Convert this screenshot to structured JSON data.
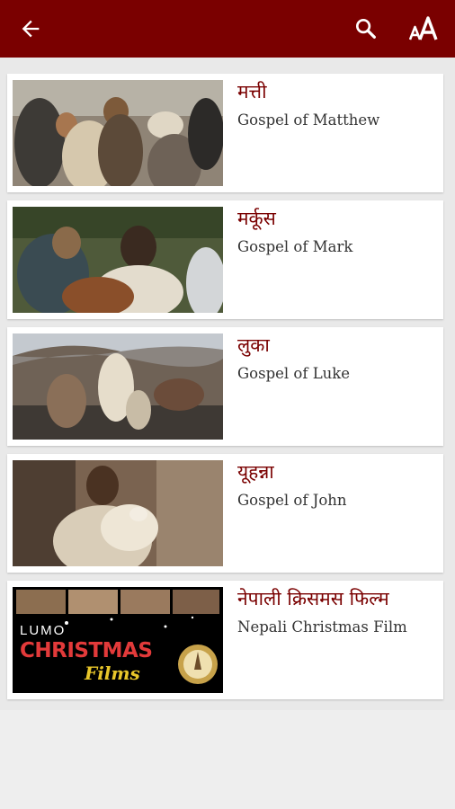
{
  "header": {
    "back_icon": "arrow-left-icon",
    "search_icon": "search-icon",
    "font_icon": "font-size-icon",
    "bar_color": "#7a0000"
  },
  "items": [
    {
      "title": "मत्ती",
      "subtitle": "Gospel of Matthew"
    },
    {
      "title": "मर्कूस",
      "subtitle": "Gospel of Mark"
    },
    {
      "title": "लुका",
      "subtitle": "Gospel of Luke"
    },
    {
      "title": "यूहन्ना",
      "subtitle": "Gospel of John"
    },
    {
      "title": "नेपाली क्रिसमस फिल्म",
      "subtitle": "Nepali Christmas Film",
      "thumbnail_text": {
        "brand": "LUMO",
        "headline": "CHRISTMAS",
        "tagline": "Films"
      }
    }
  ]
}
